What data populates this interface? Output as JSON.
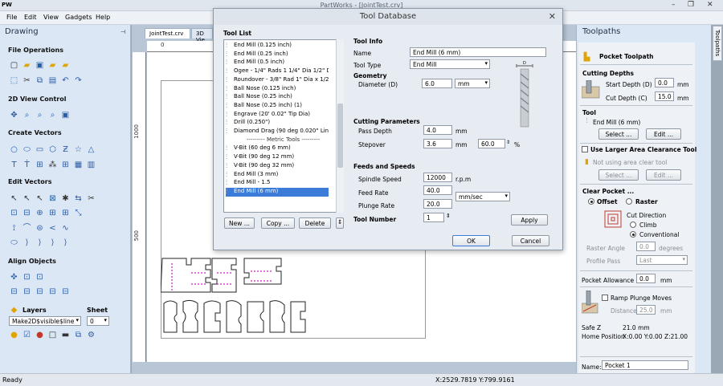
{
  "window": {
    "title": "PartWorks - [JointTest.crv]",
    "app_badge": "PW"
  },
  "menu": [
    "File",
    "Edit",
    "View",
    "Gadgets",
    "Help"
  ],
  "left_panel": {
    "title": "Drawing",
    "pin": "⊣",
    "sections": [
      "File Operations",
      "2D View Control",
      "Create Vectors",
      "Edit Vectors",
      "Align Objects"
    ],
    "layers_label": "Layers",
    "sheet_label": "Sheet",
    "layer_value": "Make2D$visible$line",
    "sheet_value": "0"
  },
  "doc": {
    "tabs": [
      "JointTest.crv",
      "3D Vie"
    ],
    "ruler_top": "0",
    "ruler_left": [
      "1000",
      "500"
    ]
  },
  "dialog": {
    "title": "Tool Database",
    "close": "✕",
    "tool_list_label": "Tool List",
    "tools": [
      "End Mill (0.125 inch)",
      "End Mill (0.25 inch)",
      "End Mill (0.5 inch)",
      "Ogee - 1/4\" Rads 1 1/4\" Dia 1/2\" Deep",
      "Roundover - 3/8\" Rad 1\" Dia x 1/2\" Deep",
      "Ball Nose (0.125 inch)",
      "Ball Nose (0.25 inch)",
      "Ball Nose (0.25 inch) (1)",
      "Engrave (20' 0.02\" Tip Dia)",
      "Drill (0.250\")",
      "Diamond Drag (90 deg 0.020\" Line Width)",
      "--------- Metric Tools ---------",
      "V-Bit (60 deg 6 mm)",
      "V-Bit (90 deg 12 mm)",
      "V-Bit (90 deg 32 mm)",
      "End Mill (3 mm)",
      "End Mill - 1.5",
      "End Mill (6 mm)"
    ],
    "selected_tool": "End Mill (6 mm)",
    "buttons": {
      "new": "New ...",
      "copy": "Copy ...",
      "delete": "Delete",
      "ok": "OK",
      "cancel": "Cancel",
      "apply": "Apply"
    },
    "tool_info": {
      "label": "Tool Info",
      "name_label": "Name",
      "name_value": "End Mill (6 mm)",
      "type_label": "Tool Type",
      "type_value": "End Mill"
    },
    "geometry": {
      "label": "Geometry",
      "diameter_label": "Diameter (D)",
      "diameter_value": "6.0",
      "unit": "mm"
    },
    "cutting": {
      "label": "Cutting Parameters",
      "pass_label": "Pass Depth",
      "pass_value": "4.0",
      "pass_unit": "mm",
      "stepover_label": "Stepover",
      "stepover_value": "3.6",
      "stepover_unit": "mm",
      "stepover_pct": "60.0",
      "pct_sign": "%"
    },
    "feeds": {
      "label": "Feeds and Speeds",
      "spindle_label": "Spindle Speed",
      "spindle_value": "12000",
      "spindle_unit": "r.p.m",
      "feed_label": "Feed Rate",
      "feed_value": "40.0",
      "feed_unit": "mm/sec",
      "plunge_label": "Plunge Rate",
      "plunge_value": "20.0"
    },
    "tool_number": {
      "label": "Tool Number",
      "value": "1"
    }
  },
  "right_panel": {
    "title": "Toolpaths",
    "vertical_tab": "Toolpaths",
    "header": "Pocket Toolpath",
    "cutting_depths": "Cutting Depths",
    "start_depth_label": "Start Depth (D)",
    "start_depth_value": "0.0",
    "start_unit": "mm",
    "cut_depth_label": "Cut Depth (C)",
    "cut_depth_value": "15.0",
    "cut_unit": "mm",
    "tool_label": "Tool",
    "tool_value": "End Mill (6 mm)",
    "select": "Select ...",
    "edit": "Edit ...",
    "larger_area": "Use Larger Area Clearance Tool",
    "no_area_tool": "Not using area clear tool",
    "clear_pocket": "Clear Pocket ...",
    "offset": "Offset",
    "raster": "Raster",
    "cut_direction": "Cut Direction",
    "climb": "Climb",
    "conventional": "Conventional",
    "raster_angle_label": "Raster Angle",
    "raster_angle_value": "0.0",
    "degrees": "degrees",
    "profile_pass_label": "Profile Pass",
    "profile_pass_value": "Last",
    "pocket_allowance_label": "Pocket Allowance",
    "pocket_allowance_value": "0.0",
    "allow_unit": "mm",
    "ramp_label": "Ramp Plunge Moves",
    "distance_label": "Distance",
    "distance_value": "25.0",
    "dist_unit": "mm",
    "safe_z_label": "Safe Z",
    "safe_z_value": "21.0 mm",
    "home_label": "Home Position",
    "home_value": "X:0.00 Y:0.00 Z:21.00",
    "name_label": "Name:",
    "name_value": "Pocket 1"
  },
  "status": {
    "left": "Ready",
    "coords": "X:2529.7819 Y:799.9161"
  },
  "colors": {
    "selection": "#3d7bd8",
    "panel": "#dbe7f5",
    "magenta": "#d020c0"
  }
}
